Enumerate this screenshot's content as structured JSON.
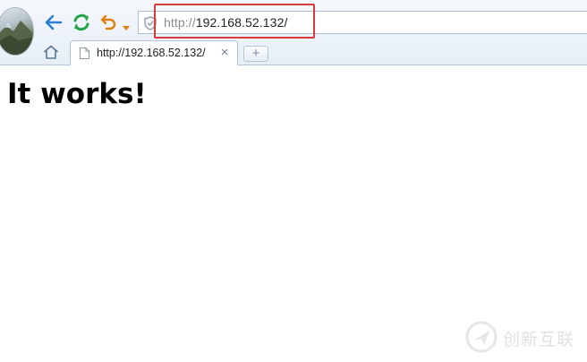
{
  "toolbar": {
    "back_icon": "back-arrow-icon",
    "refresh_icon": "refresh-icon",
    "undo_icon": "undo-icon",
    "dropdown_icon": "chevron-down-icon",
    "home_icon": "home-icon",
    "accent_back": "#2a7fd0",
    "accent_refresh": "#27a34a",
    "accent_undo": "#e07f10"
  },
  "address_bar": {
    "protocol": "http://",
    "host_path": "192.168.52.132/",
    "security_icon": "shield-icon",
    "highlight_color": "#d93a3a"
  },
  "tabs": [
    {
      "title": "http://192.168.52.132/",
      "icon": "page-icon",
      "close_glyph": "×"
    }
  ],
  "new_tab": {
    "glyph": "+"
  },
  "page": {
    "heading": "It works!"
  },
  "watermark": {
    "text": "创新互联",
    "logo_icon": "brand-logo-icon"
  }
}
